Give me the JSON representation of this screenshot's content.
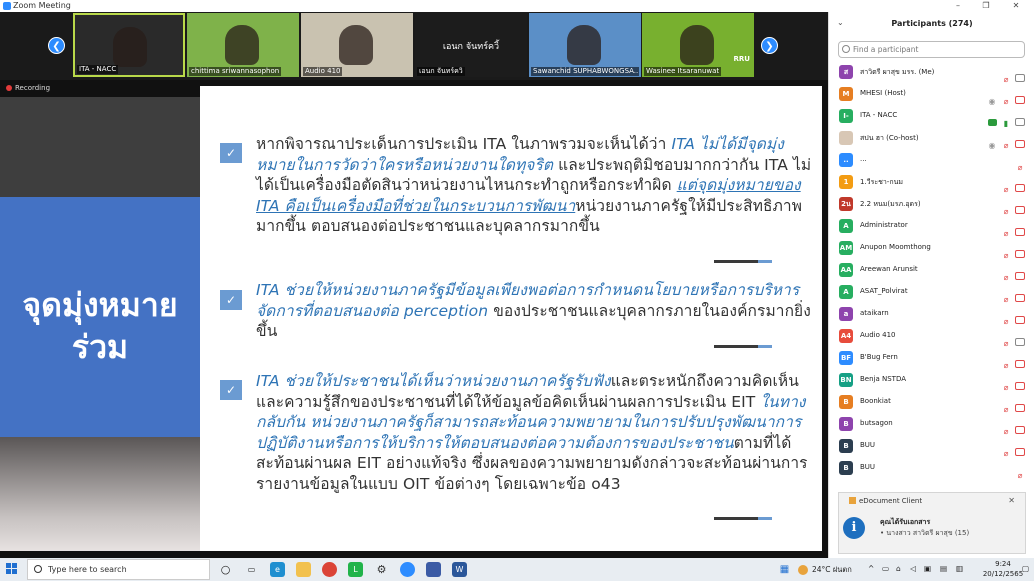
{
  "window": {
    "title": "Zoom Meeting",
    "controls": [
      "–",
      "❐",
      "✕"
    ]
  },
  "gallery": {
    "tiles": [
      {
        "name": "ITA - NACC",
        "bg": "#2a2a2a",
        "active": true
      },
      {
        "name": "chittima sriwannasophon",
        "bg": "#7fb24a",
        "active": false
      },
      {
        "name": "Audio 410",
        "bg": "#c9c2b0",
        "active": false
      },
      {
        "name": "เอนก จันทร์ควิ้",
        "bg": "#1c1c1c",
        "active": false,
        "center_label": "เอนก จันทร์ควิ้"
      },
      {
        "name": "Sawanchid SUPHABWONGSA...",
        "bg": "#5b8fc7",
        "active": false
      },
      {
        "name": "Wasinee Itsaranuwat",
        "bg": "#78b02f",
        "active": false,
        "badge": "RRU"
      }
    ]
  },
  "recording_label": "Recording",
  "slide": {
    "title_line1": "จุดมุ่งหมาย",
    "title_line2": "ร่วม",
    "bullets": [
      {
        "parts": [
          {
            "t": "หากพิจารณาประเด็นการประเมิน ITA ในภาพรวมจะเห็นได้ว่า ",
            "s": ""
          },
          {
            "t": "ITA ไม่ได้มีจุดมุ่งหมายในการวัดว่าใครหรือหน่วยงานใดทุจริต",
            "s": "blue"
          },
          {
            "t": " และประพฤติมิชอบมากกว่ากัน ITA ไม่ได้เป็นเครื่องมือตัดสินว่าหน่วยงานไหนกระทำถูกหรือกระทำผิด ",
            "s": ""
          },
          {
            "t": "แต่จุดมุ่งหมายของ ITA คือเป็นเครื่องมือที่ช่วยในกระบวนการพัฒนา",
            "s": "blue uline"
          },
          {
            "t": "หน่วยงานภาครัฐให้มีประสิทธิภาพมากขึ้น ตอบสนองต่อประชาชนและบุคลากรมากขึ้น",
            "s": ""
          }
        ]
      },
      {
        "parts": [
          {
            "t": "ITA ช่วยให้หน่วยงานภาครัฐมีข้อมูลเพียงพอต่อการกำหนดนโยบายหรือการบริหารจัดการที่ตอบสนองต่อ perception",
            "s": "blue"
          },
          {
            "t": " ของประชาชนและบุคลากรภายในองค์กรมากยิ่งขึ้น",
            "s": ""
          }
        ]
      },
      {
        "parts": [
          {
            "t": "ITA ช่วยให้ประชาชนได้เห็นว่าหน่วยงานภาครัฐรับฟัง",
            "s": "blue"
          },
          {
            "t": "และตระหนักถึงความคิดเห็นและความรู้สึกของประชาชนที่ได้ให้ข้อมูลข้อคิดเห็นผ่านผลการประเมิน EIT ",
            "s": ""
          },
          {
            "t": "ในทางกลับกัน หน่วยงานภาครัฐก็สามารถสะท้อนความพยายามในการปรับปรุงพัฒนาการปฏิบัติงานหรือการให้บริการให้ตอบสนองต่อความต้องการของประชาชน",
            "s": "blue"
          },
          {
            "t": "ตามที่ได้สะท้อนผ่านผล EIT อย่างแท้จริง ซึ่งผลของความพยายามดังกล่าวจะสะท้อนผ่านการรายงานข้อมูลในแบบ OIT ข้อต่างๆ โดยเฉพาะข้อ o43",
            "s": ""
          }
        ]
      }
    ]
  },
  "participants": {
    "title": "Participants (274)",
    "search_placeholder": "Find a participant",
    "items": [
      {
        "name": "สาวิตรี ผาสุข มรร. (Me)",
        "avatar": "ส",
        "color": "#8e44ad",
        "icons": [
          "mic-off",
          "vid"
        ]
      },
      {
        "name": "MHESI (Host)",
        "avatar": "M",
        "color": "#e67e22",
        "icons": [
          "eye",
          "mic-off",
          "vid-off"
        ]
      },
      {
        "name": "ITA - NACC",
        "avatar": "I-",
        "color": "#27ae60",
        "icons": [
          "green-rect",
          "mic-on",
          "vid-on"
        ]
      },
      {
        "name": "สปน ฮา (Co-host)",
        "avatar": "",
        "color": "#d8c7b5",
        "icons": [
          "eye",
          "mic-off",
          "vid-off"
        ]
      },
      {
        "name": "...",
        "avatar": "..",
        "color": "#2d8cff",
        "icons": [
          "mic-off"
        ]
      },
      {
        "name": "1.วีระชา-กนม",
        "avatar": "1",
        "color": "#f39c12",
        "icons": [
          "mic-off",
          "vid-off"
        ]
      },
      {
        "name": "2.2 หนม(มรภ.อุดร)",
        "avatar": "2น",
        "color": "#c0392b",
        "icons": [
          "mic-off",
          "vid-off"
        ]
      },
      {
        "name": "Administrator",
        "avatar": "A",
        "color": "#27ae60",
        "icons": [
          "mic-off",
          "vid-off"
        ]
      },
      {
        "name": "Anupon Moomthong",
        "avatar": "AM",
        "color": "#27ae60",
        "icons": [
          "mic-off",
          "vid-off"
        ]
      },
      {
        "name": "Areewan Arunsit",
        "avatar": "AA",
        "color": "#27ae60",
        "icons": [
          "mic-off",
          "vid-off"
        ]
      },
      {
        "name": "ASAT_Polvirat",
        "avatar": "A",
        "color": "#27ae60",
        "icons": [
          "mic-off",
          "vid-off"
        ]
      },
      {
        "name": "ataikarn",
        "avatar": "a",
        "color": "#8e44ad",
        "icons": [
          "mic-off",
          "vid-off"
        ]
      },
      {
        "name": "Audio 410",
        "avatar": "A4",
        "color": "#e74c3c",
        "icons": [
          "mic-off",
          "vid"
        ]
      },
      {
        "name": "B'Bug Fern",
        "avatar": "BF",
        "color": "#2d8cff",
        "icons": [
          "mic-off",
          "vid-off"
        ]
      },
      {
        "name": "Benja NSTDA",
        "avatar": "BN",
        "color": "#16a085",
        "icons": [
          "mic-off",
          "vid-off"
        ]
      },
      {
        "name": "Boonkiat",
        "avatar": "B",
        "color": "#e67e22",
        "icons": [
          "mic-off",
          "vid-off"
        ]
      },
      {
        "name": "butsagon",
        "avatar": "B",
        "color": "#8e44ad",
        "icons": [
          "mic-off",
          "vid-off"
        ]
      },
      {
        "name": "BUU",
        "avatar": "B",
        "color": "#2c3e50",
        "icons": [
          "mic-off",
          "vid-off"
        ]
      },
      {
        "name": "BUU",
        "avatar": "B",
        "color": "#2c3e50",
        "icons": [
          "mic-off"
        ]
      }
    ]
  },
  "notification": {
    "app": "eDocument Client",
    "title": "คุณได้รับเอกสาร",
    "body": "• นางสาว สาวิตรี   ผาสุข   (15)",
    "close": "✕"
  },
  "taskbar": {
    "search_placeholder": "Type here to search",
    "weather": "24°C  ฝนตก",
    "time": "9:24",
    "date": "20/12/2565"
  }
}
